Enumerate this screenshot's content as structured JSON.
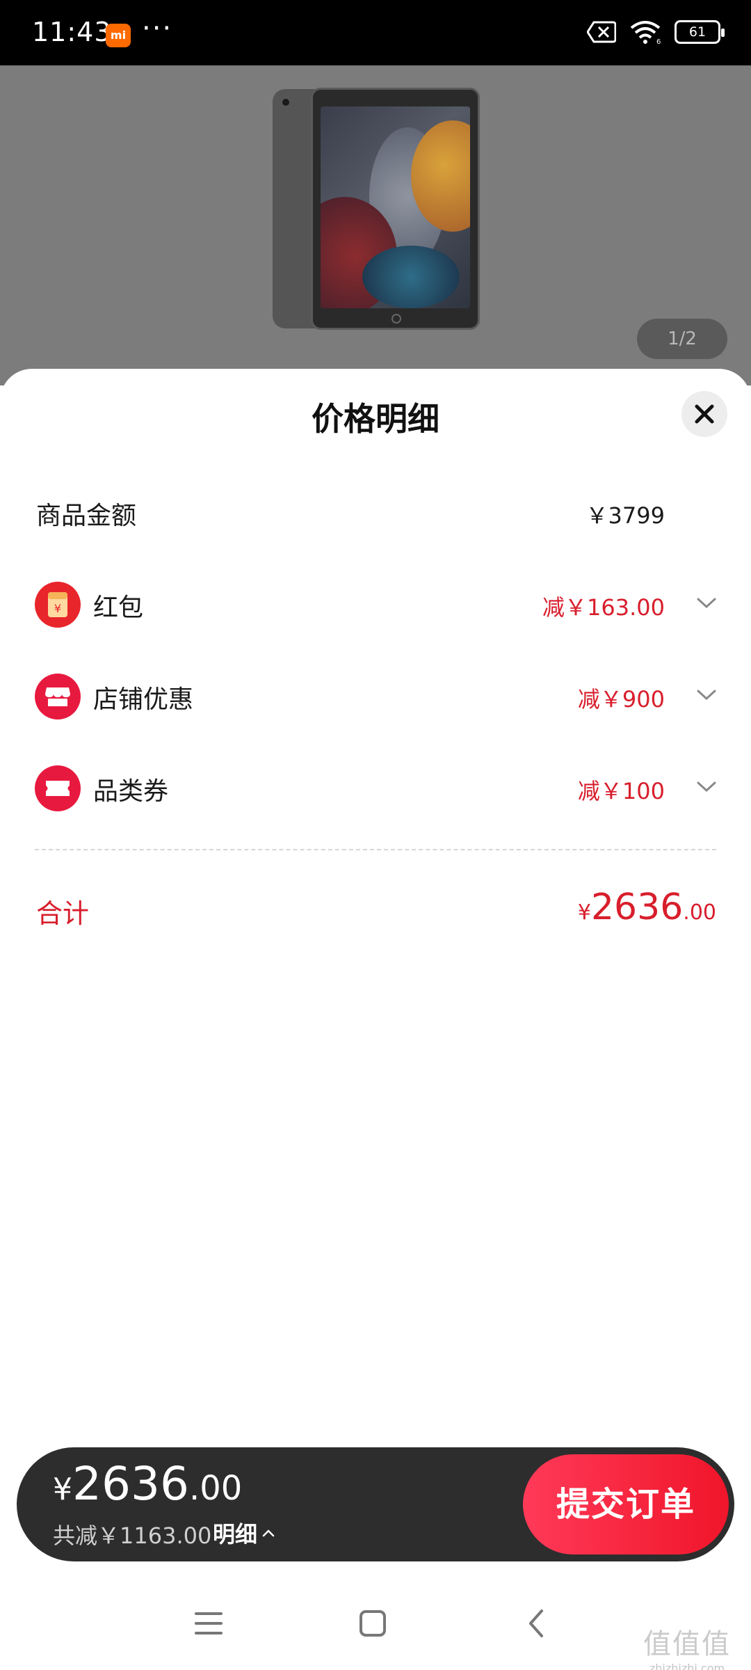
{
  "status_bar": {
    "time": "11:43",
    "app_badge": "mi",
    "more_dots": "···",
    "battery": "61"
  },
  "product": {
    "page_indicator": "1/2"
  },
  "sheet": {
    "title": "价格明细",
    "goods_amount_label": "商品金额",
    "goods_amount_value": "￥3799",
    "rows": [
      {
        "label": "红包",
        "value": "减￥163.00",
        "icon": "red-packet-icon"
      },
      {
        "label": "店铺优惠",
        "value": "减￥900",
        "icon": "shop-icon"
      },
      {
        "label": "品类券",
        "value": "减￥100",
        "icon": "ticket-icon"
      }
    ],
    "total_label": "合计",
    "total_currency": "¥",
    "total_int": "2636",
    "total_dec": ".00"
  },
  "checkout": {
    "currency": "¥",
    "price_int": "2636",
    "price_dec": ".00",
    "discount_text": "共减￥1163.00",
    "detail_label": "明细",
    "submit_label": "提交订单"
  },
  "watermark": {
    "big": "值值值",
    "small": "zhizhizhi.com"
  },
  "colors": {
    "accent_red": "#d81e2c",
    "submit_gradient_start": "#ff3a58",
    "submit_gradient_end": "#f0152a",
    "bar_bg": "#2d2d2d"
  }
}
